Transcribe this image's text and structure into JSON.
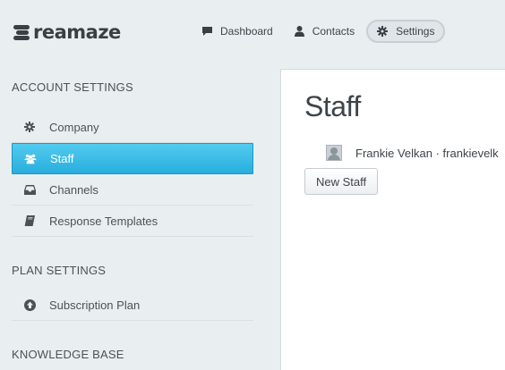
{
  "brand": {
    "name": "reamaze"
  },
  "nav": {
    "items": [
      {
        "label": "Dashboard",
        "icon": "chat-bubble-icon",
        "active": false
      },
      {
        "label": "Contacts",
        "icon": "person-icon",
        "active": false
      },
      {
        "label": "Settings",
        "icon": "gear-icon",
        "active": true
      }
    ]
  },
  "sidebar": {
    "account_title": "ACCOUNT SETTINGS",
    "account_items": [
      {
        "label": "Company",
        "icon": "gear-icon",
        "active": false
      },
      {
        "label": "Staff",
        "icon": "people-icon",
        "active": true
      },
      {
        "label": "Channels",
        "icon": "inbox-icon",
        "active": false
      },
      {
        "label": "Response Templates",
        "icon": "book-icon",
        "active": false
      }
    ],
    "plan_title": "PLAN SETTINGS",
    "plan_items": [
      {
        "label": "Subscription Plan",
        "icon": "upload-circle-icon",
        "active": false
      }
    ],
    "kb_title": "KNOWLEDGE BASE"
  },
  "main": {
    "title": "Staff",
    "staff": [
      {
        "name_email": "Frankie Velkan · frankievelk"
      }
    ],
    "new_staff_label": "New Staff"
  },
  "colors": {
    "accent": "#35b8e6",
    "background": "#e9eef1",
    "panel": "#ffffff",
    "text": "#3d4449"
  }
}
